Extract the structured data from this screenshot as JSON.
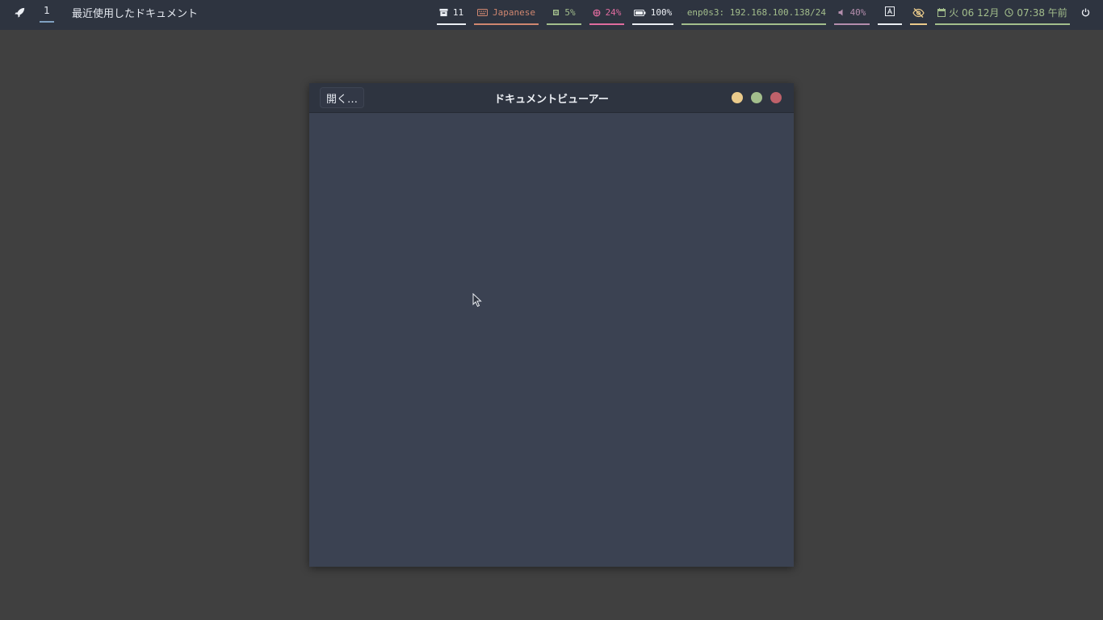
{
  "topbar": {
    "launcher_icon": "rocket-icon",
    "workspace": "1",
    "window_title": "最近使用したドキュメント",
    "modules": {
      "updates": {
        "icon": "package-icon",
        "value": "11",
        "color": "#eceff4",
        "underline": "#eceff4"
      },
      "keyboard": {
        "icon": "keyboard-icon",
        "value": "Japanese",
        "color": "#d08770",
        "underline": "#d08770"
      },
      "cpu": {
        "icon": "cpu-icon",
        "value": "5%",
        "color": "#a3be8c",
        "underline": "#a3be8c"
      },
      "memory": {
        "icon": "memory-icon",
        "value": "24%",
        "color": "#e06c9f",
        "underline": "#e06c9f"
      },
      "battery": {
        "icon": "battery-icon",
        "value": "100%",
        "color": "#eceff4",
        "underline": "#eceff4"
      },
      "network": {
        "icon": "link-icon",
        "value": "enp0s3: 192.168.100.138/24",
        "color": "#a3be8c",
        "underline": "#a3be8c"
      },
      "volume": {
        "icon": "speaker-icon",
        "value": "40%",
        "color": "#b48ead",
        "underline": "#b48ead"
      },
      "keyboard_layout": {
        "icon": "keyboard-layout-icon",
        "color": "#eceff4",
        "underline": "#eceff4"
      },
      "idle_inhibitor": {
        "icon": "eye-off-icon",
        "color": "#ebcb8b",
        "underline": "#ebcb8b"
      },
      "datetime": {
        "date_icon": "calendar-icon",
        "date": "火 06 12月",
        "time_icon": "clock-icon",
        "time": "07:38 午前",
        "color": "#a3be8c",
        "underline": "#a3be8c"
      },
      "power": {
        "icon": "power-icon"
      }
    }
  },
  "window": {
    "title": "ドキュメントビューアー",
    "open_button": "開く…",
    "controls": {
      "minimize": "#ebcb8b",
      "maximize": "#a3be8c",
      "close": "#bf616a"
    }
  }
}
